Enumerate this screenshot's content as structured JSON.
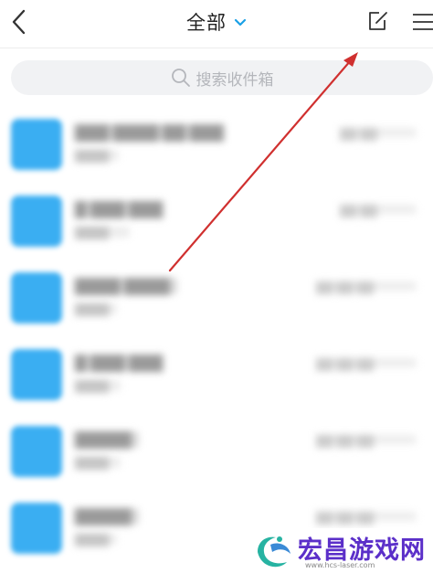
{
  "header": {
    "title": "全部",
    "back_icon": "back-arrow-icon",
    "dropdown_icon": "chevron-down-icon",
    "compose_icon": "compose-icon",
    "menu_icon": "menu-icon",
    "accent_color": "#1aa0e6"
  },
  "search": {
    "placeholder": "搜索收件箱",
    "icon": "search-icon"
  },
  "mail_list": {
    "avatar_color": "#3aaef2",
    "items": [
      {
        "sender": "███ ████ ██ ███",
        "preview": "████",
        "time": "██ ██"
      },
      {
        "sender": "█ ███ ███",
        "preview": "████",
        "time": "██ ██"
      },
      {
        "sender": "████ ████",
        "preview": "████",
        "time": "██ ██ ██"
      },
      {
        "sender": "█ ███ ███",
        "preview": "████",
        "time": "██ ██ ██"
      },
      {
        "sender": "█████",
        "preview": "████",
        "time": "██ ██ ██"
      },
      {
        "sender": "█████",
        "preview": "████",
        "time": "██ ██ ██"
      }
    ]
  },
  "annotation": {
    "arrow_color": "#d0302f",
    "points_to": "compose-button"
  },
  "watermark": {
    "name": "宏昌游戏网",
    "url": "www.hcs-laser.com",
    "color": "#5b2fc9"
  }
}
